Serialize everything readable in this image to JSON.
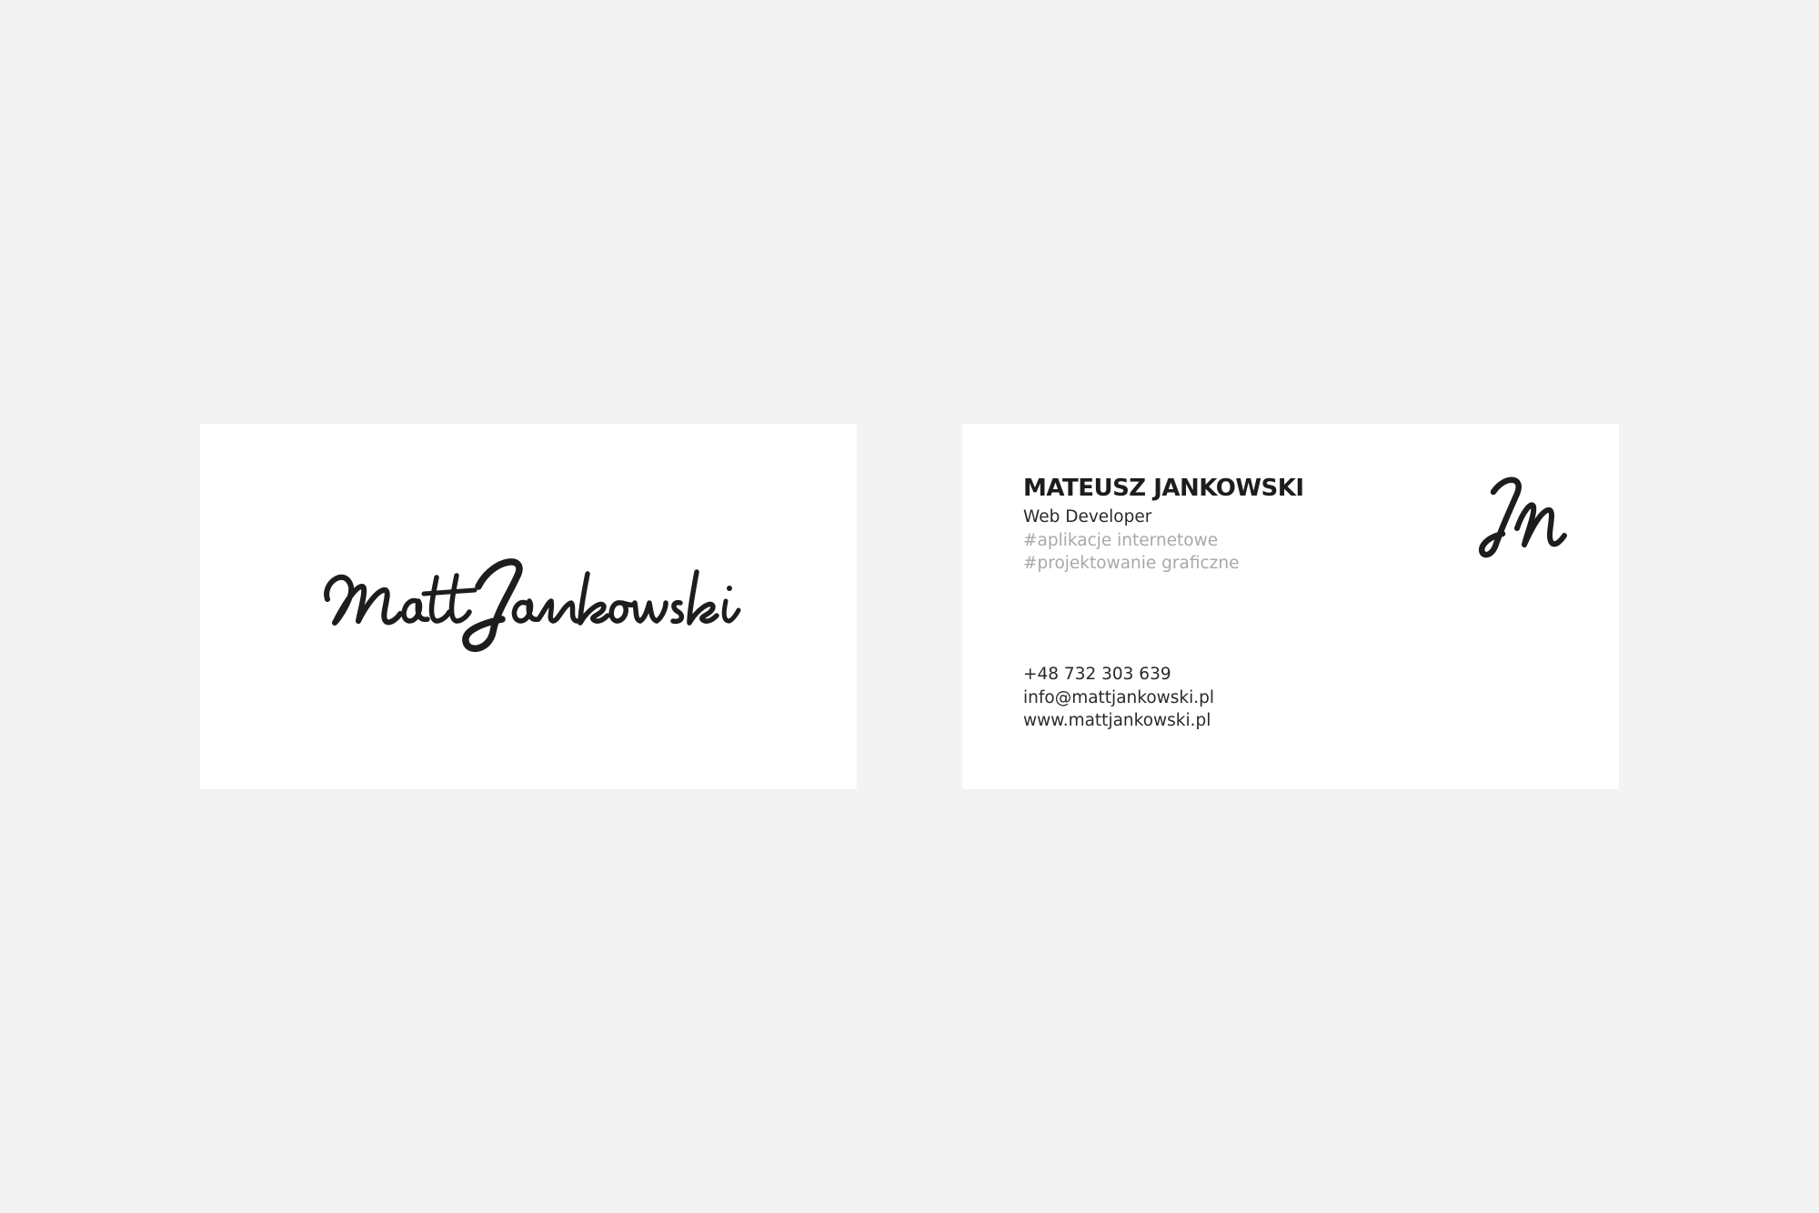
{
  "colors": {
    "background": "#f3f3f3",
    "card": "#ffffff",
    "ink": "#1e1c1c",
    "muted_text": "#a8a8a8"
  },
  "front": {
    "logo": {
      "icon": "signature-logo",
      "text": "MattJankowski"
    }
  },
  "back": {
    "monogram": {
      "icon": "jm-monogram",
      "text": "JM"
    },
    "name": "MATEUSZ JANKOWSKI",
    "role": "Web Developer",
    "tags": [
      "#aplikacje internetowe",
      "#projektowanie graficzne"
    ],
    "contacts": {
      "phone": "+48 732 303 639",
      "email": "info@mattjankowski.pl",
      "website": "www.mattjankowski.pl"
    }
  }
}
